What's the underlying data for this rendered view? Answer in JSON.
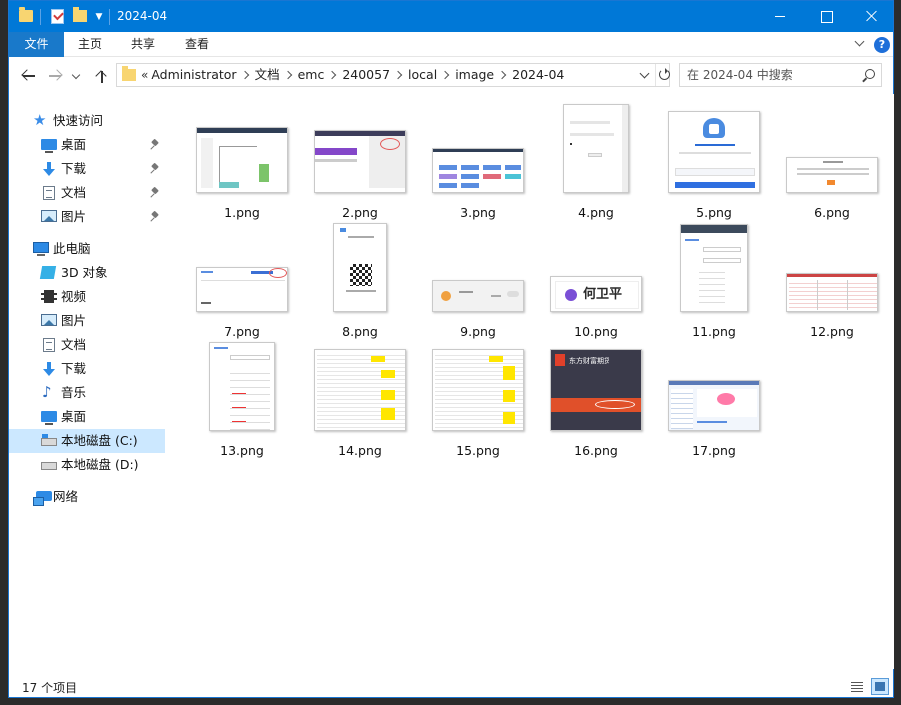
{
  "window": {
    "title": "2024-04"
  },
  "ribbon": {
    "tabs": [
      "文件",
      "主页",
      "共享",
      "查看"
    ]
  },
  "address": {
    "more": "«",
    "crumbs": [
      "Administrator",
      "文档",
      "emc",
      "240057",
      "local",
      "image",
      "2024-04"
    ]
  },
  "search": {
    "placeholder": "在 2024-04 中搜索"
  },
  "sidebar": {
    "quick_access": "快速访问",
    "quick_items": [
      "桌面",
      "下载",
      "文档",
      "图片"
    ],
    "this_pc": "此电脑",
    "pc_items": [
      "3D 对象",
      "视频",
      "图片",
      "文档",
      "下载",
      "音乐",
      "桌面",
      "本地磁盘 (C:)",
      "本地磁盘 (D:)"
    ],
    "network": "网络"
  },
  "files": [
    {
      "name": "1.png"
    },
    {
      "name": "2.png"
    },
    {
      "name": "3.png"
    },
    {
      "name": "4.png"
    },
    {
      "name": "5.png"
    },
    {
      "name": "6.png"
    },
    {
      "name": "7.png"
    },
    {
      "name": "8.png"
    },
    {
      "name": "9.png"
    },
    {
      "name": "10.png"
    },
    {
      "name": "11.png"
    },
    {
      "name": "12.png"
    },
    {
      "name": "13.png"
    },
    {
      "name": "14.png"
    },
    {
      "name": "15.png"
    },
    {
      "name": "16.png"
    },
    {
      "name": "17.png"
    }
  ],
  "thumb_text": {
    "t10": "何卫平",
    "t16": "东方财富期货"
  },
  "status": {
    "count": "17 个项目"
  },
  "colors": {
    "titlebar": "#0078d7",
    "file_tab": "#1979ca",
    "selected": "#cce8ff",
    "folder": "#f8d571"
  }
}
